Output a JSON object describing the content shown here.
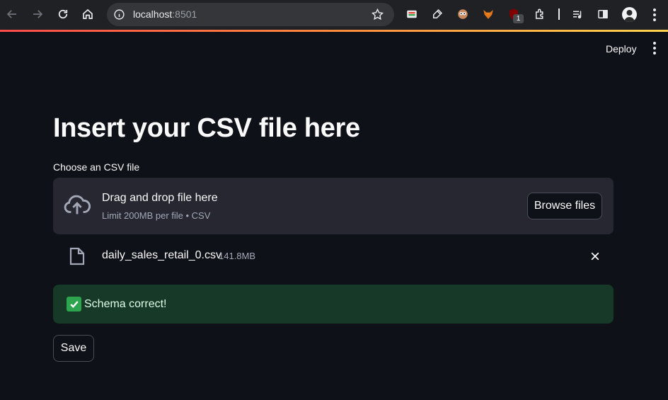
{
  "browser": {
    "url_host": "localhost",
    "url_port": ":8501",
    "extension_badge": "1",
    "icons": [
      "back-icon",
      "forward-icon",
      "reload-icon",
      "home-icon",
      "info-icon",
      "star-icon",
      "extensions-icon",
      "reading-list-icon",
      "side-panel-icon",
      "profile-avatar",
      "menu-icon"
    ]
  },
  "app_header": {
    "deploy_label": "Deploy"
  },
  "main": {
    "title": "Insert your CSV file here",
    "uploader": {
      "label": "Choose an CSV file",
      "drop_title": "Drag and drop file here",
      "limit_text": "Limit 200MB per file • CSV",
      "browse_label": "Browse files"
    },
    "uploaded_file": {
      "name": "daily_sales_retail_0.csv",
      "size": "141.8MB"
    },
    "alert": {
      "message": "Schema correct!"
    },
    "save_label": "Save"
  },
  "colors": {
    "background": "#0e1117",
    "dropzone": "#262730",
    "success_bg": "#173928",
    "success_text": "#dffde9",
    "accent_gradient_start": "#ff4b4b",
    "accent_gradient_end": "#ffd34d"
  }
}
